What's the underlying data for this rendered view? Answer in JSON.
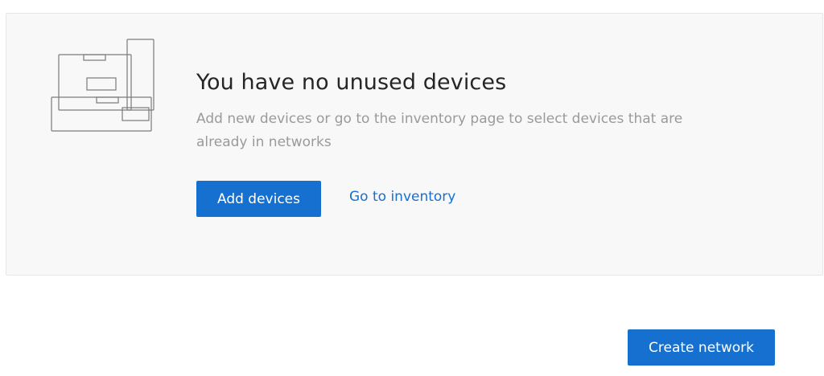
{
  "empty_state": {
    "illustration": "devices-stack-illustration",
    "title": "You have no unused devices",
    "description": "Add new devices or go to the inventory page to select devices that are already in networks",
    "add_devices_label": "Add devices",
    "go_to_inventory_label": "Go to inventory"
  },
  "footer": {
    "create_network_label": "Create network"
  },
  "colors": {
    "accent": "#1670d0",
    "panel_background": "#f8f8f8",
    "title_text": "#262626",
    "muted_text": "#9a9a9a"
  }
}
